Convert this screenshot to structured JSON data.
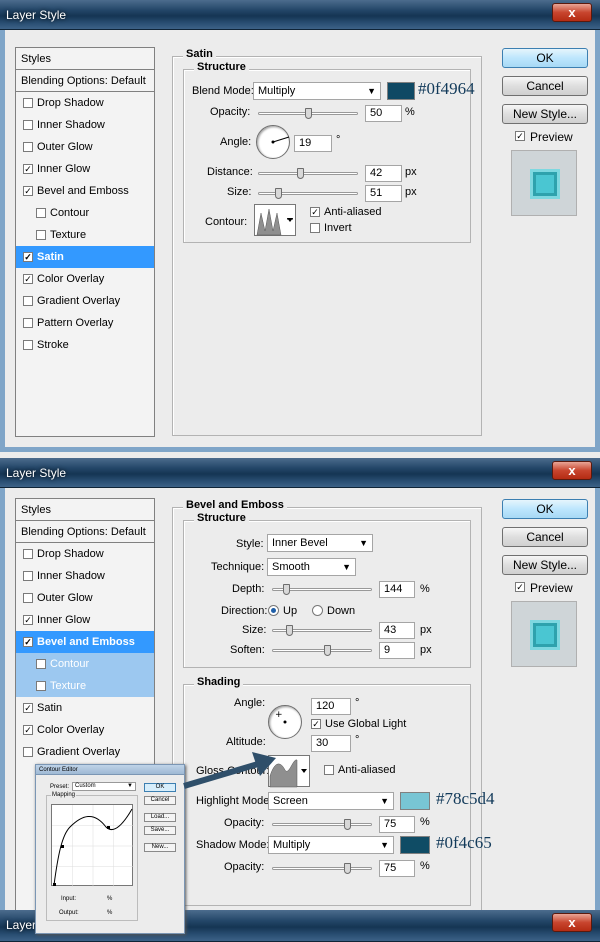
{
  "window_title": "Layer Style",
  "close_symbol": "x",
  "styles_header": "Styles",
  "blending_options": "Blending Options: Default",
  "dialog1": {
    "style_items": [
      {
        "label": "Drop Shadow",
        "checked": false,
        "sub": false,
        "state": ""
      },
      {
        "label": "Inner Shadow",
        "checked": false,
        "sub": false,
        "state": ""
      },
      {
        "label": "Outer Glow",
        "checked": false,
        "sub": false,
        "state": ""
      },
      {
        "label": "Inner Glow",
        "checked": true,
        "sub": false,
        "state": ""
      },
      {
        "label": "Bevel and Emboss",
        "checked": true,
        "sub": false,
        "state": ""
      },
      {
        "label": "Contour",
        "checked": false,
        "sub": true,
        "state": ""
      },
      {
        "label": "Texture",
        "checked": false,
        "sub": true,
        "state": ""
      },
      {
        "label": "Satin",
        "checked": true,
        "sub": false,
        "state": "selected"
      },
      {
        "label": "Color Overlay",
        "checked": true,
        "sub": false,
        "state": ""
      },
      {
        "label": "Gradient Overlay",
        "checked": false,
        "sub": false,
        "state": ""
      },
      {
        "label": "Pattern Overlay",
        "checked": false,
        "sub": false,
        "state": ""
      },
      {
        "label": "Stroke",
        "checked": false,
        "sub": false,
        "state": ""
      }
    ],
    "section_title": "Satin",
    "structure_title": "Structure",
    "blend_mode_label": "Blend Mode:",
    "blend_mode_value": "Multiply",
    "color_hex_label": "#0f4964",
    "color": "#0f4964",
    "opacity_label": "Opacity:",
    "opacity_value": "50",
    "opacity_level": 0.5,
    "percent_unit": "%",
    "angle_label": "Angle:",
    "angle_value": "19",
    "degree_unit": "°",
    "distance_label": "Distance:",
    "distance_value": "42",
    "distance_level": 0.42,
    "px_unit": "px",
    "size_label": "Size:",
    "size_value": "51",
    "size_level": 0.2,
    "contour_label": "Contour:",
    "anti_aliased_label": "Anti-aliased",
    "anti_aliased_checked": true,
    "invert_label": "Invert",
    "invert_checked": false
  },
  "buttons": {
    "ok": "OK",
    "cancel": "Cancel",
    "new_style": "New Style...",
    "preview": "Preview"
  },
  "dialog2": {
    "style_items": [
      {
        "label": "Drop Shadow",
        "checked": false,
        "sub": false,
        "state": ""
      },
      {
        "label": "Inner Shadow",
        "checked": false,
        "sub": false,
        "state": ""
      },
      {
        "label": "Outer Glow",
        "checked": false,
        "sub": false,
        "state": ""
      },
      {
        "label": "Inner Glow",
        "checked": true,
        "sub": false,
        "state": ""
      },
      {
        "label": "Bevel and Emboss",
        "checked": true,
        "sub": false,
        "state": "selected"
      },
      {
        "label": "Contour",
        "checked": false,
        "sub": true,
        "state": "highlight"
      },
      {
        "label": "Texture",
        "checked": false,
        "sub": true,
        "state": "highlight"
      },
      {
        "label": "Satin",
        "checked": true,
        "sub": false,
        "state": ""
      },
      {
        "label": "Color Overlay",
        "checked": true,
        "sub": false,
        "state": ""
      },
      {
        "label": "Gradient Overlay",
        "checked": false,
        "sub": false,
        "state": ""
      }
    ],
    "section_title": "Bevel and Emboss",
    "structure_title": "Structure",
    "style_label": "Style:",
    "style_value": "Inner Bevel",
    "technique_label": "Technique:",
    "technique_value": "Smooth",
    "depth_label": "Depth:",
    "depth_value": "144",
    "depth_level": 0.14,
    "percent_unit": "%",
    "direction_label": "Direction:",
    "direction_up": "Up",
    "direction_down": "Down",
    "size_label": "Size:",
    "size_value": "43",
    "size_level": 0.17,
    "soften_label": "Soften:",
    "soften_value": "9",
    "soften_level": 0.55,
    "px_unit": "px",
    "shading_title": "Shading",
    "angle_label": "Angle:",
    "angle_value": "120",
    "degree_unit": "°",
    "use_global_light_label": "Use Global Light",
    "use_global_light_checked": true,
    "altitude_label": "Altitude:",
    "altitude_value": "30",
    "gloss_contour_label": "Gloss Contour:",
    "anti_aliased_label": "Anti-aliased",
    "anti_aliased_checked": false,
    "highlight_mode_label": "Highlight Mode:",
    "highlight_mode_value": "Screen",
    "highlight_color_hex_label": "#78c5d4",
    "highlight_color": "#78c5d4",
    "highlight_opacity_label": "Opacity:",
    "highlight_opacity_value": "75",
    "highlight_opacity_level": 0.75,
    "shadow_mode_label": "Shadow Mode:",
    "shadow_mode_value": "Multiply",
    "shadow_color_hex_label": "#0f4c65",
    "shadow_color": "#0f4c65",
    "shadow_opacity_label": "Opacity:",
    "shadow_opacity_value": "75",
    "shadow_opacity_level": 0.75
  },
  "contour_editor": {
    "title": "Contour Editor",
    "preset_label": "Preset:",
    "preset_value": "Custom",
    "mapping_label": "Mapping",
    "input_label": "Input:",
    "output_label": "Output:",
    "percent_unit": "%",
    "ok": "OK",
    "cancel": "Cancel",
    "load": "Load...",
    "save": "Save...",
    "new": "New..."
  },
  "dialog3": {
    "title_fragment": "Layer"
  },
  "icons": [
    "close-icon",
    "chevron-down-icon",
    "checkmark-icon",
    "angle-dial-icon",
    "contour-curve-icon",
    "pointer-arrow-icon"
  ]
}
